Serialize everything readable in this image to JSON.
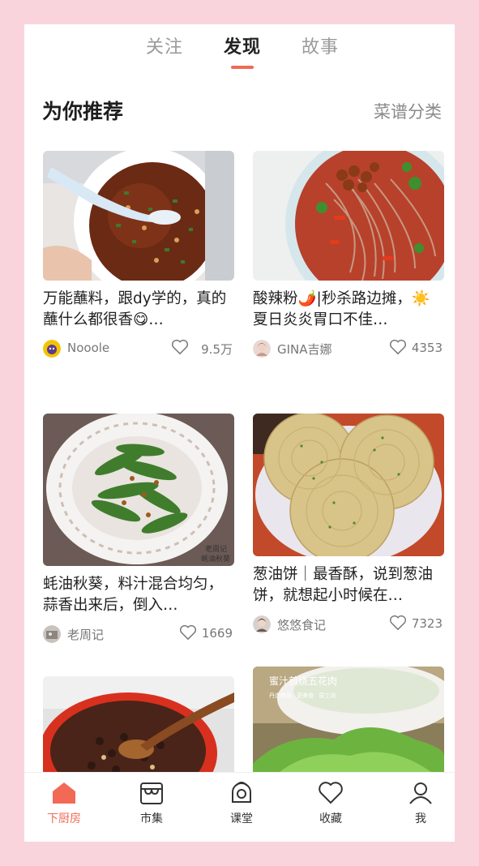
{
  "top_tabs": [
    "关注",
    "发现",
    "故事"
  ],
  "section": {
    "title": "为你推荐",
    "category_link": "菜谱分类"
  },
  "cards": [
    {
      "title": "万能蘸料，跟dy学的，真的蘸什么都很香😋…",
      "author": "Nooole",
      "likes": "9.5万"
    },
    {
      "title": "酸辣粉🌶️|秒杀路边摊，☀️夏日炎炎胃口不佳…",
      "author": "GINA吉娜",
      "likes": "4353"
    },
    {
      "title": "蚝油秋葵，料汁混合均匀，蒜香出来后，倒入…",
      "author": "老周记",
      "likes": "1669",
      "watermark": [
        "老周记",
        "蚝油秋葵"
      ]
    },
    {
      "title": "葱油饼｜最香酥，说到葱油饼，就想起小时候在…",
      "author": "悠悠食记",
      "likes": "7323"
    },
    {
      "title": "",
      "author": "",
      "likes": ""
    },
    {
      "title": "",
      "author": "",
      "likes": "",
      "overlay": [
        "蜜汁煎烧五花肉",
        "丹虎商品 · 更美食 · 原工坊"
      ]
    }
  ],
  "tabbar": [
    "下厨房",
    "市集",
    "课堂",
    "收藏",
    "我"
  ],
  "colors": {
    "accent": "#f26a55",
    "frame": "#f9d4dc"
  }
}
